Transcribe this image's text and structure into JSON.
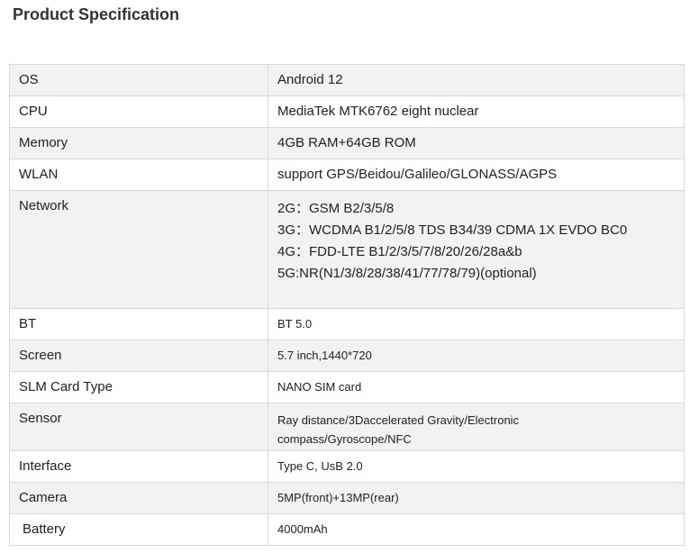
{
  "title": "Product Specification",
  "rows": [
    {
      "key": "OS",
      "value": "Android 12"
    },
    {
      "key": "CPU",
      "value": "MediaTek MTK6762 eight nuclear"
    },
    {
      "key": "Memory",
      "value": "4GB RAM+64GB ROM"
    },
    {
      "key": "WLAN",
      "value": "support GPS/Beidou/Galileo/GLONASS/AGPS"
    },
    {
      "key": "Network",
      "lines": [
        "2G：GSM B2/3/5/8",
        "3G：WCDMA B1/2/5/8 TDS B34/39 CDMA 1X EVDO BC0",
        "4G：FDD-LTE B1/2/3/5/7/8/20/26/28a&b",
        "5G:NR(N1/3/8/28/38/41/77/78/79)(optional)"
      ]
    },
    {
      "key": "BT",
      "value": "BT 5.0"
    },
    {
      "key": "Screen",
      "value": "5.7 inch,1440*720"
    },
    {
      "key": "SLM Card Type",
      "value": "NANO SIM card"
    },
    {
      "key": "Sensor",
      "lines": [
        "Ray distance/3Daccelerated Gravity/Electronic",
        "compass/Gyroscope/NFC"
      ]
    },
    {
      "key": "Interface",
      "value": "Type C, UsB 2.0"
    },
    {
      "key": "Camera",
      "value": "5MP(front)+13MP(rear)"
    },
    {
      "key": "Battery",
      "value": "4000mAh"
    }
  ]
}
